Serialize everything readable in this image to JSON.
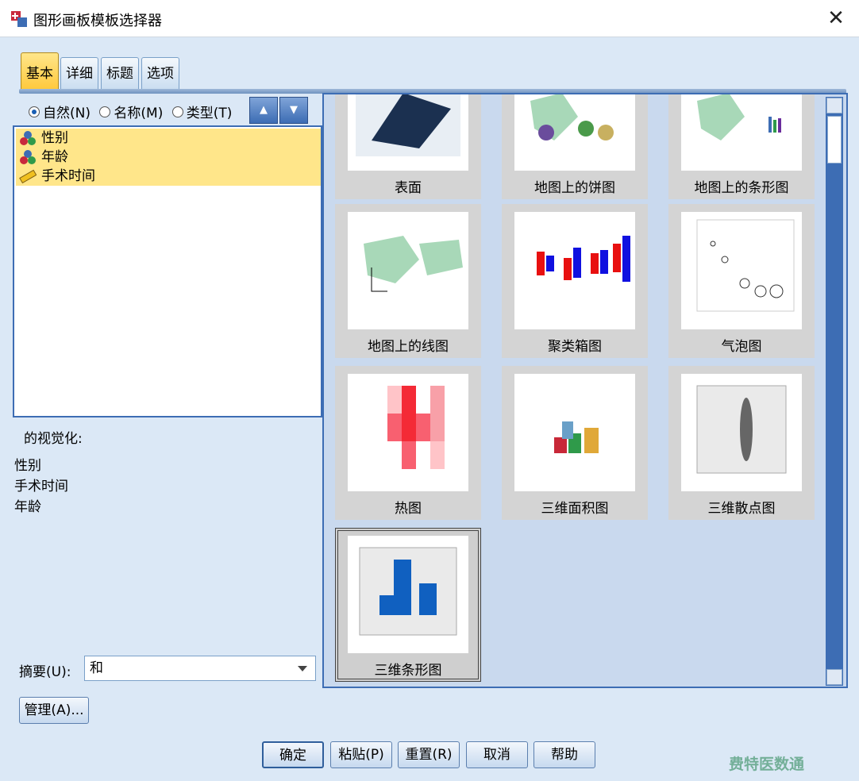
{
  "window": {
    "title": "图形画板模板选择器"
  },
  "tabs": [
    {
      "label": "基本",
      "active": true
    },
    {
      "label": "详细",
      "active": false
    },
    {
      "label": "标题",
      "active": false
    },
    {
      "label": "选项",
      "active": false
    }
  ],
  "sort": {
    "options": [
      {
        "label": "自然(N)",
        "selected": true
      },
      {
        "label": "名称(M)",
        "selected": false
      },
      {
        "label": "类型(T)",
        "selected": false
      }
    ]
  },
  "variables": [
    {
      "label": "性别",
      "icon": "nominal-icon"
    },
    {
      "label": "年龄",
      "icon": "nominal-icon"
    },
    {
      "label": "手术时间",
      "icon": "scale-icon"
    }
  ],
  "visualization": {
    "label": "的视觉化:",
    "items": [
      "性别",
      "手术时间",
      "年龄"
    ]
  },
  "summary": {
    "label": "摘要(U):",
    "value": "和"
  },
  "manage_button": "管理(A)...",
  "gallery": [
    {
      "label": "表面",
      "selected": false
    },
    {
      "label": "地图上的饼图",
      "selected": false
    },
    {
      "label": "地图上的条形图",
      "selected": false
    },
    {
      "label": "地图上的线图",
      "selected": false
    },
    {
      "label": "聚类箱图",
      "selected": false
    },
    {
      "label": "气泡图",
      "selected": false
    },
    {
      "label": "热图",
      "selected": false
    },
    {
      "label": "三维面积图",
      "selected": false
    },
    {
      "label": "三维散点图",
      "selected": false
    },
    {
      "label": "三维条形图",
      "selected": true
    }
  ],
  "footer_buttons": {
    "ok": "确定",
    "paste": "粘贴(P)",
    "reset": "重置(R)",
    "cancel": "取消",
    "help": "帮助"
  },
  "watermark": "费特医数通"
}
